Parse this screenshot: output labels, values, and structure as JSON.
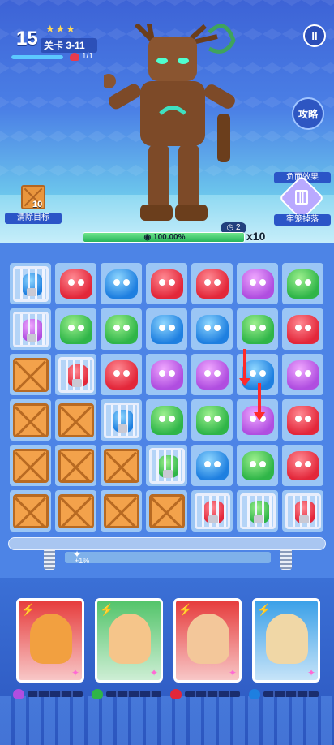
{
  "level": {
    "number": "15",
    "stars": "★★★",
    "stage": "关卡 3-11",
    "wave": "1/1",
    "wave_progress": 1.0
  },
  "pause_label": "II",
  "guide_label": "攻略",
  "goal": {
    "label": "清除目标",
    "count": "10",
    "item": "crate-icon"
  },
  "effect": {
    "title": "负面效果",
    "label": "牢笼掉落",
    "icon": "cage-icon"
  },
  "boss": {
    "name": "tree-golem",
    "timer": "2",
    "hp_text": "100.00%",
    "hp_fraction": 1.0,
    "multiplier": "x10"
  },
  "board": {
    "rows": [
      [
        "cage-blue",
        "red",
        "blue",
        "red",
        "red",
        "purple",
        "green"
      ],
      [
        "cage-purple",
        "green",
        "green",
        "blue",
        "blue",
        "green",
        "red"
      ],
      [
        "crate",
        "cage-red",
        "red",
        "purple",
        "purple",
        "blue",
        "purple"
      ],
      [
        "crate",
        "crate",
        "cage-blue",
        "green",
        "green",
        "purple",
        "red"
      ],
      [
        "crate",
        "crate",
        "crate",
        "cage-green",
        "blue",
        "green",
        "red"
      ],
      [
        "crate",
        "crate",
        "crate",
        "crate",
        "cage-red",
        "cage-green",
        "cage-red"
      ]
    ],
    "hint_arrows": [
      "col6-row2",
      "col6-row3"
    ]
  },
  "energy": {
    "text": "+1%",
    "icon": "paw-icon"
  },
  "heroes": [
    {
      "name": "monkey-king",
      "bg": "#e63c3c",
      "skin": "#f2a040",
      "element": "purple"
    },
    {
      "name": "flower-girl",
      "bg": "#53c46a",
      "skin": "#f5c58a",
      "element": "green"
    },
    {
      "name": "opera-hero",
      "bg": "#e63c3c",
      "skin": "#f3c79a",
      "element": "red"
    },
    {
      "name": "skull-girl",
      "bg": "#3aa0e8",
      "skin": "#f0d7a6",
      "element": "blue"
    }
  ],
  "colors": {
    "red": "#e3273a",
    "blue": "#1e7fe0",
    "green": "#2fb548",
    "purple": "#b04ee0"
  }
}
